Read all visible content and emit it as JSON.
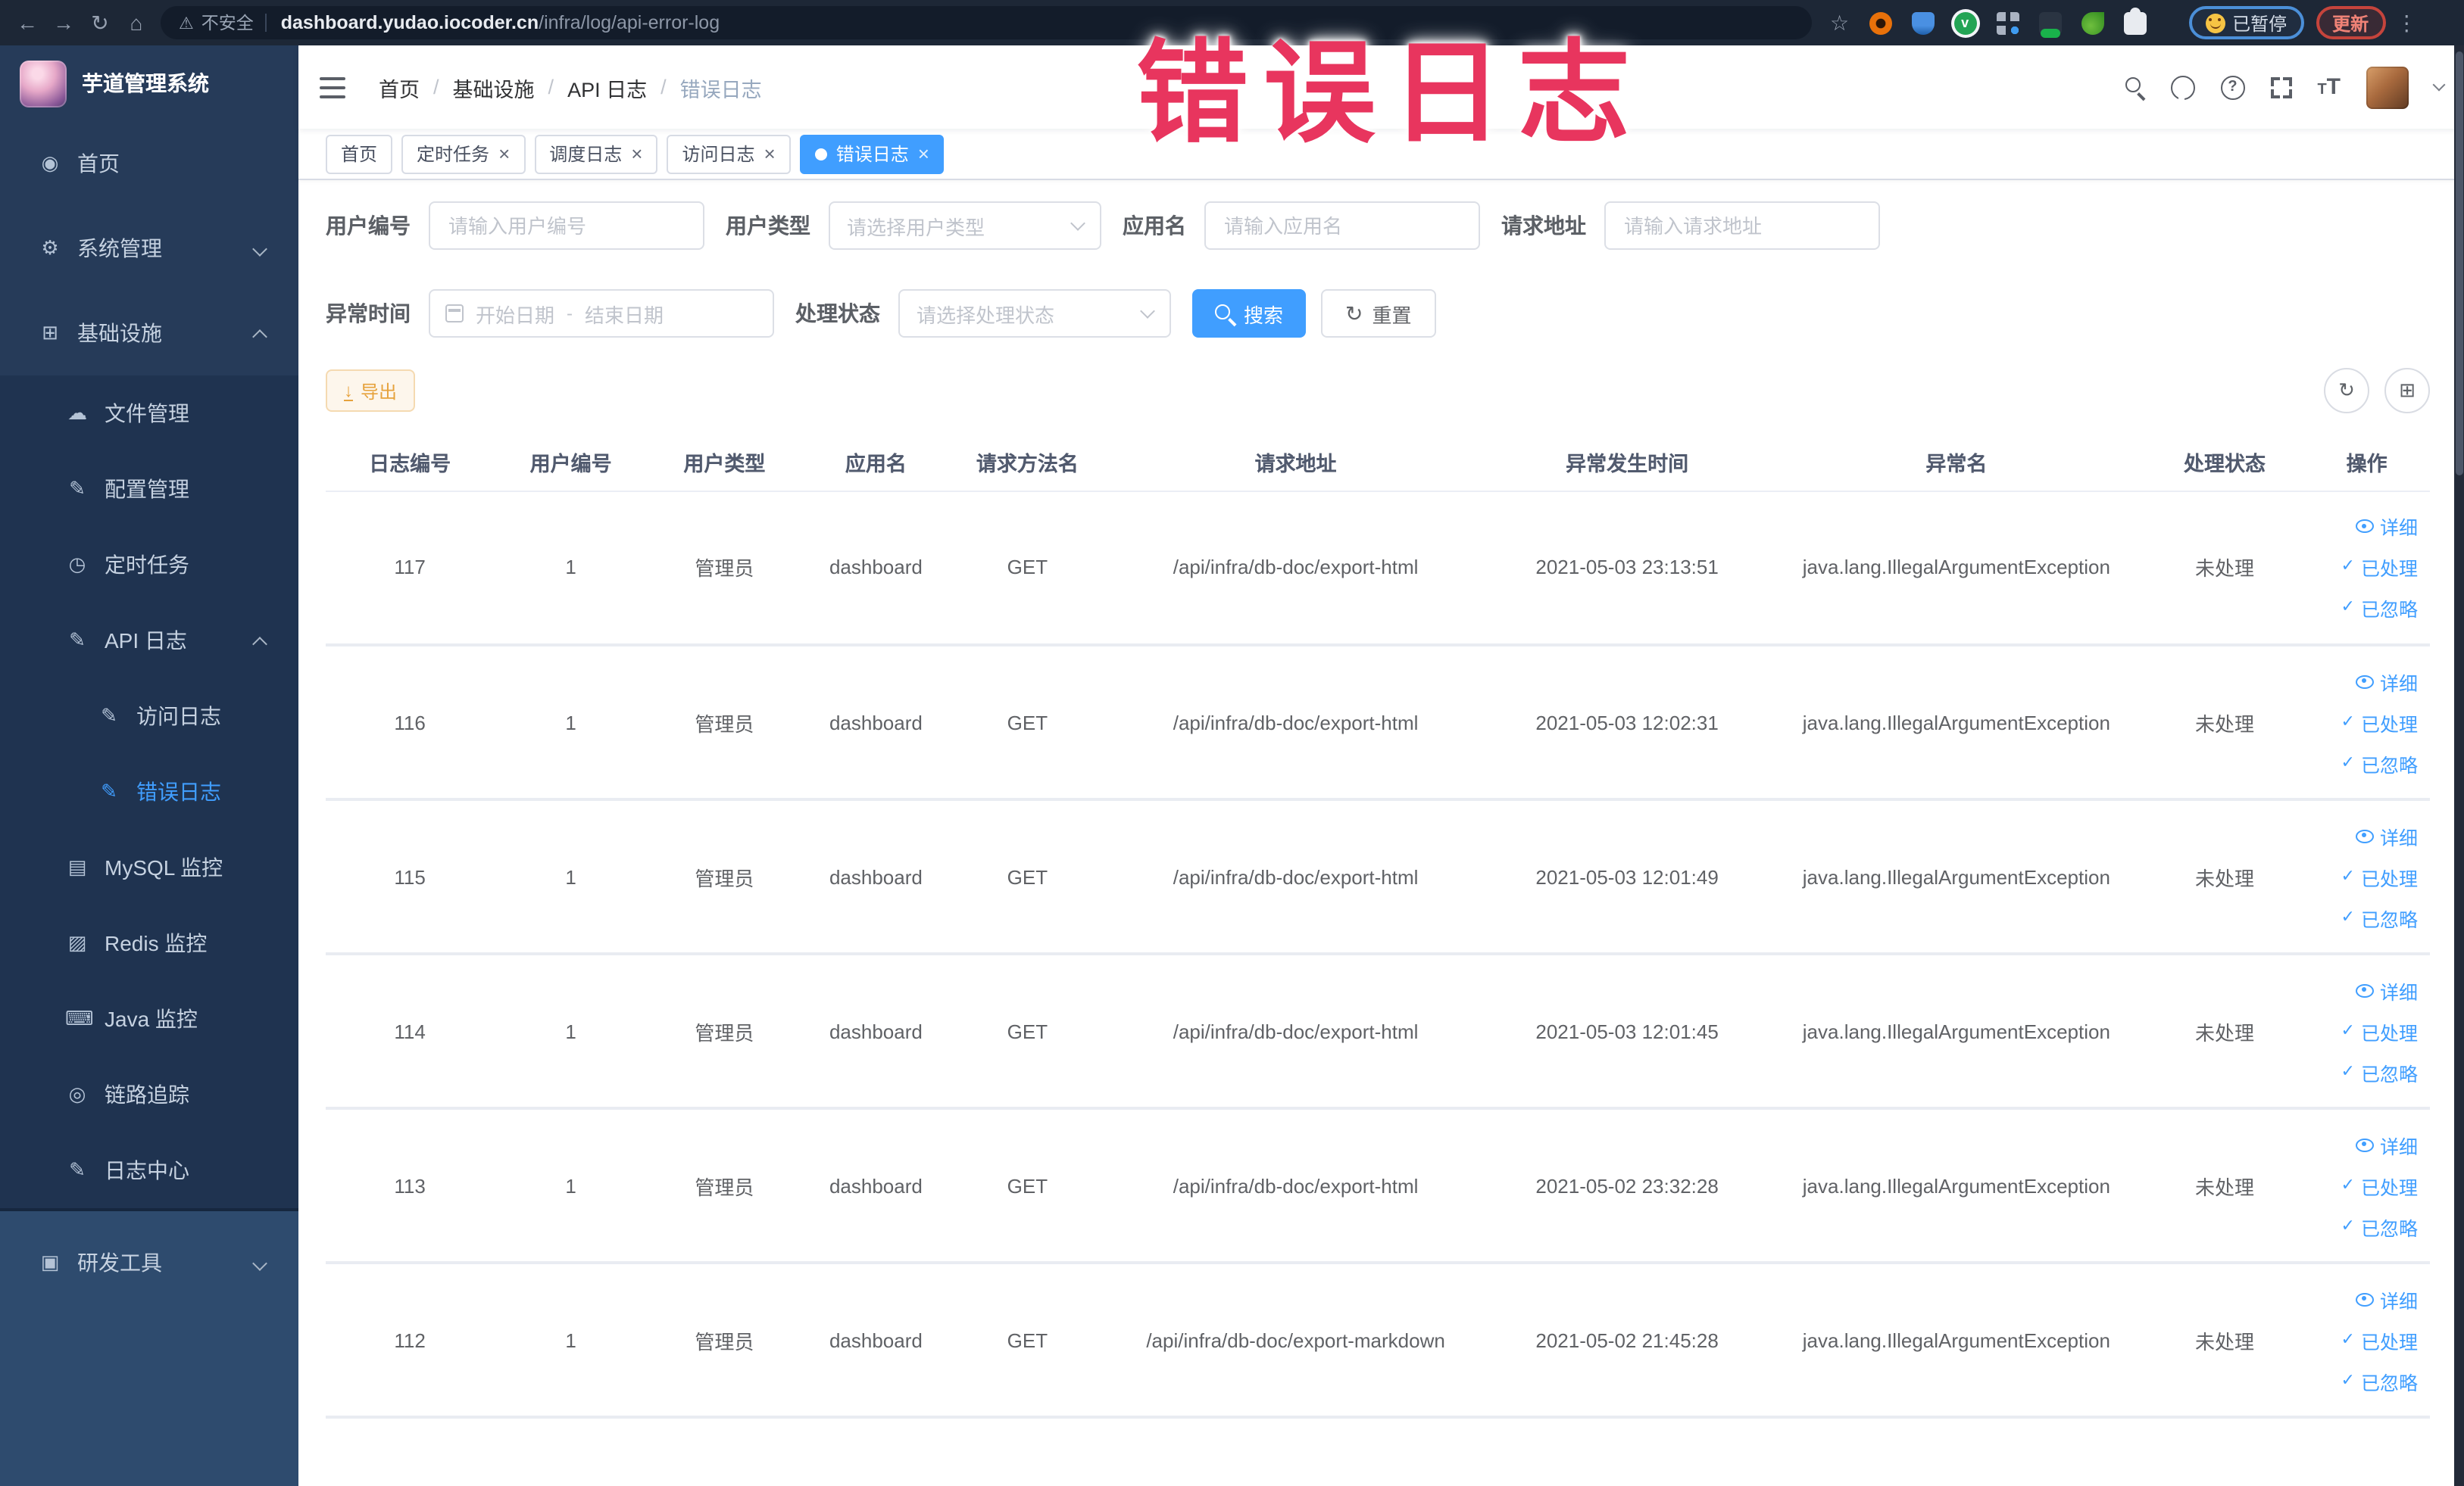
{
  "browser": {
    "security_label": "不安全",
    "url_domain": "dashboard.yudao.iocoder.cn",
    "url_path": "/infra/log/api-error-log",
    "paused_label": "已暂停",
    "update_label": "更新"
  },
  "overlay": {
    "watermark": "错误日志"
  },
  "sidebar": {
    "app_title": "芋道管理系统",
    "home": "首页",
    "system": "系统管理",
    "infra": "基础设施",
    "file": "文件管理",
    "config": "配置管理",
    "job": "定时任务",
    "api_log": "API 日志",
    "access_log": "访问日志",
    "error_log": "错误日志",
    "mysql": "MySQL 监控",
    "redis": "Redis 监控",
    "java": "Java 监控",
    "trace": "链路追踪",
    "log_center": "日志中心",
    "dev_tools": "研发工具"
  },
  "header": {
    "breadcrumb": [
      "首页",
      "基础设施",
      "API 日志",
      "错误日志"
    ]
  },
  "tabs": [
    {
      "label": "首页"
    },
    {
      "label": "定时任务"
    },
    {
      "label": "调度日志"
    },
    {
      "label": "访问日志"
    },
    {
      "label": "错误日志"
    }
  ],
  "filters": {
    "user_id_label": "用户编号",
    "user_id_placeholder": "请输入用户编号",
    "user_type_label": "用户类型",
    "user_type_placeholder": "请选择用户类型",
    "app_name_label": "应用名",
    "app_name_placeholder": "请输入应用名",
    "request_url_label": "请求地址",
    "request_url_placeholder": "请输入请求地址",
    "exception_time_label": "异常时间",
    "start_date_placeholder": "开始日期",
    "end_date_placeholder": "结束日期",
    "range_separator": "-",
    "process_status_label": "处理状态",
    "process_status_placeholder": "请选择处理状态",
    "search_label": "搜索",
    "reset_label": "重置"
  },
  "toolbar": {
    "export_label": "导出"
  },
  "table": {
    "columns": [
      "日志编号",
      "用户编号",
      "用户类型",
      "应用名",
      "请求方法名",
      "请求地址",
      "异常发生时间",
      "异常名",
      "处理状态",
      "操作"
    ],
    "actions": {
      "detail": "详细",
      "processed": "已处理",
      "ignored": "已忽略"
    },
    "rows": [
      {
        "log_id": "117",
        "user_id": "1",
        "user_type": "管理员",
        "app_name": "dashboard",
        "method": "GET",
        "url": "/api/infra/db-doc/export-html",
        "time": "2021-05-03 23:13:51",
        "exception": "java.lang.IllegalArgumentException",
        "status": "未处理"
      },
      {
        "log_id": "116",
        "user_id": "1",
        "user_type": "管理员",
        "app_name": "dashboard",
        "method": "GET",
        "url": "/api/infra/db-doc/export-html",
        "time": "2021-05-03 12:02:31",
        "exception": "java.lang.IllegalArgumentException",
        "status": "未处理"
      },
      {
        "log_id": "115",
        "user_id": "1",
        "user_type": "管理员",
        "app_name": "dashboard",
        "method": "GET",
        "url": "/api/infra/db-doc/export-html",
        "time": "2021-05-03 12:01:49",
        "exception": "java.lang.IllegalArgumentException",
        "status": "未处理"
      },
      {
        "log_id": "114",
        "user_id": "1",
        "user_type": "管理员",
        "app_name": "dashboard",
        "method": "GET",
        "url": "/api/infra/db-doc/export-html",
        "time": "2021-05-03 12:01:45",
        "exception": "java.lang.IllegalArgumentException",
        "status": "未处理"
      },
      {
        "log_id": "113",
        "user_id": "1",
        "user_type": "管理员",
        "app_name": "dashboard",
        "method": "GET",
        "url": "/api/infra/db-doc/export-html",
        "time": "2021-05-02 23:32:28",
        "exception": "java.lang.IllegalArgumentException",
        "status": "未处理"
      },
      {
        "log_id": "112",
        "user_id": "1",
        "user_type": "管理员",
        "app_name": "dashboard",
        "method": "GET",
        "url": "/api/infra/db-doc/export-markdown",
        "time": "2021-05-02 21:45:28",
        "exception": "java.lang.IllegalArgumentException",
        "status": "未处理"
      }
    ]
  },
  "colors": {
    "primary": "#409eff",
    "warning_button": "#e6a23c",
    "active_tab": "#409eff",
    "watermark": "#e8355e",
    "sidebar_bg": "#263b59",
    "chrome_bg": "#1d2736",
    "update_button_red": "#c5443c"
  }
}
